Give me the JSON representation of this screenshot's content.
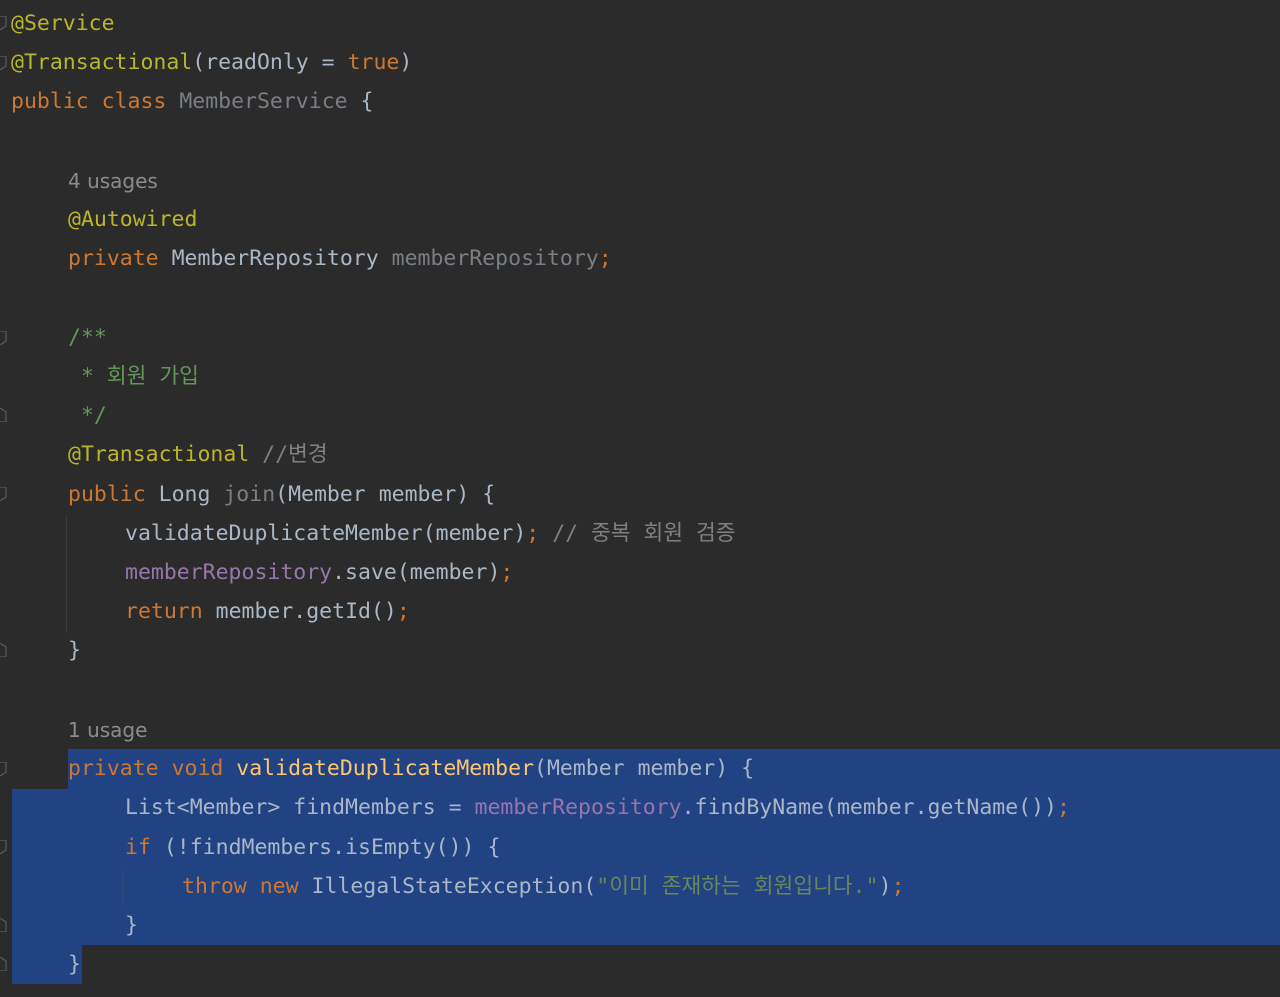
{
  "code": {
    "l1": {
      "ann": "@Service"
    },
    "l2": {
      "ann": "@Transactional",
      "p1": "(readOnly = ",
      "kw": "true",
      "p2": ")"
    },
    "l3": {
      "kw1": "public",
      "kw2": "class",
      "cls": "MemberService",
      "brace": "{"
    },
    "hint1": "4 usages",
    "l5": {
      "ann": "@Autowired"
    },
    "l6": {
      "kw": "private",
      "type": "MemberRepository",
      "name": "memberRepository",
      "semi": ";"
    },
    "l7": {
      "text": "/**"
    },
    "l8": {
      "text": " * 회원 가입"
    },
    "l9": {
      "text": " */"
    },
    "l10": {
      "ann": "@Transactional",
      "cmt": "//변경"
    },
    "l11": {
      "kw": "public",
      "type": "Long",
      "name": "join",
      "params": "(Member member) {"
    },
    "l12": {
      "call": "validateDuplicateMember(member)",
      "semi": ";",
      "cmt": "// 중복 회원 검증"
    },
    "l13": {
      "fld": "memberRepository",
      "rest": ".save(member)",
      "semi": ";"
    },
    "l14": {
      "kw": "return",
      "rest": "member.getId()",
      "semi": ";"
    },
    "l15": {
      "text": "}"
    },
    "hint2": "1 usage",
    "l17": {
      "kw1": "private",
      "kw2": "void",
      "fn": "validateDuplicateMember",
      "params": "(Member member) {"
    },
    "l18": {
      "p1": "List<Member> findMembers = ",
      "fld": "memberRepository",
      "p2": ".findByName(member.getName())",
      "semi": ";"
    },
    "l19": {
      "kw": "if",
      "rest": "(!findMembers.isEmpty()) {"
    },
    "l20": {
      "kw1": "throw",
      "kw2": "new",
      "cls": "IllegalStateException",
      "open": "(",
      "str": "\"이미 존재하는 회원입니다.\"",
      "close": ")",
      "semi": ";"
    },
    "l21": {
      "text": "}"
    },
    "l22": {
      "text": "}"
    }
  }
}
